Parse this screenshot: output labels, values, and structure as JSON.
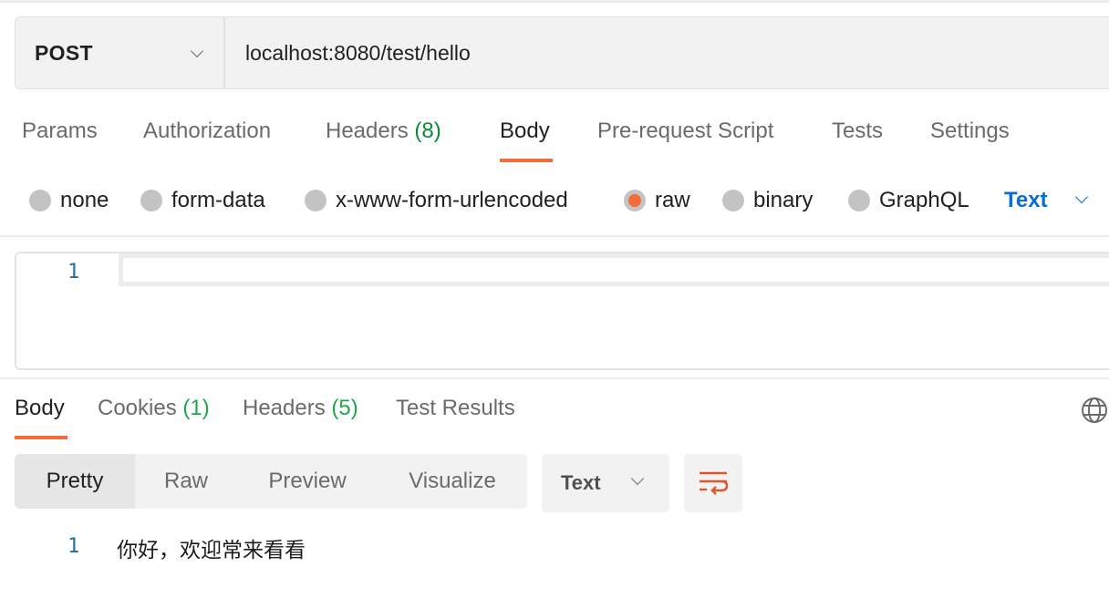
{
  "request": {
    "method": "POST",
    "url": "localhost:8080/test/hello"
  },
  "request_tabs": [
    {
      "label": "Params",
      "count": null,
      "active": false
    },
    {
      "label": "Authorization",
      "count": null,
      "active": false
    },
    {
      "label": "Headers",
      "count": "(8)",
      "active": false
    },
    {
      "label": "Body",
      "count": null,
      "active": true
    },
    {
      "label": "Pre-request Script",
      "count": null,
      "active": false
    },
    {
      "label": "Tests",
      "count": null,
      "active": false
    },
    {
      "label": "Settings",
      "count": null,
      "active": false
    }
  ],
  "body_types": [
    {
      "label": "none",
      "checked": false
    },
    {
      "label": "form-data",
      "checked": false
    },
    {
      "label": "x-www-form-urlencoded",
      "checked": false
    },
    {
      "label": "raw",
      "checked": true
    },
    {
      "label": "binary",
      "checked": false
    },
    {
      "label": "GraphQL",
      "checked": false
    }
  ],
  "raw_language": "Text",
  "editor": {
    "line_numbers": [
      "1"
    ],
    "content": ""
  },
  "response_tabs": [
    {
      "label": "Body",
      "count": null,
      "active": true
    },
    {
      "label": "Cookies",
      "count": "(1)",
      "active": false
    },
    {
      "label": "Headers",
      "count": "(5)",
      "active": false
    },
    {
      "label": "Test Results",
      "count": null,
      "active": false
    }
  ],
  "response_views": [
    {
      "label": "Pretty",
      "active": true
    },
    {
      "label": "Raw",
      "active": false
    },
    {
      "label": "Preview",
      "active": false
    },
    {
      "label": "Visualize",
      "active": false
    }
  ],
  "response_format": "Text",
  "response_body": {
    "lines": [
      {
        "number": "1",
        "text": "你好，欢迎常来看看"
      }
    ]
  },
  "icons": {
    "method_dropdown": "chevron-down-icon",
    "language_dropdown": "chevron-down-icon",
    "format_dropdown": "chevron-down-icon",
    "wrap": "word-wrap-icon",
    "network": "globe-icon"
  },
  "colors": {
    "accent": "#f26b3a",
    "link_blue": "#0a6cd6",
    "count_green": "#0b8a3d",
    "response_count_green": "#1ea84a",
    "line_number": "#2a6e91"
  }
}
